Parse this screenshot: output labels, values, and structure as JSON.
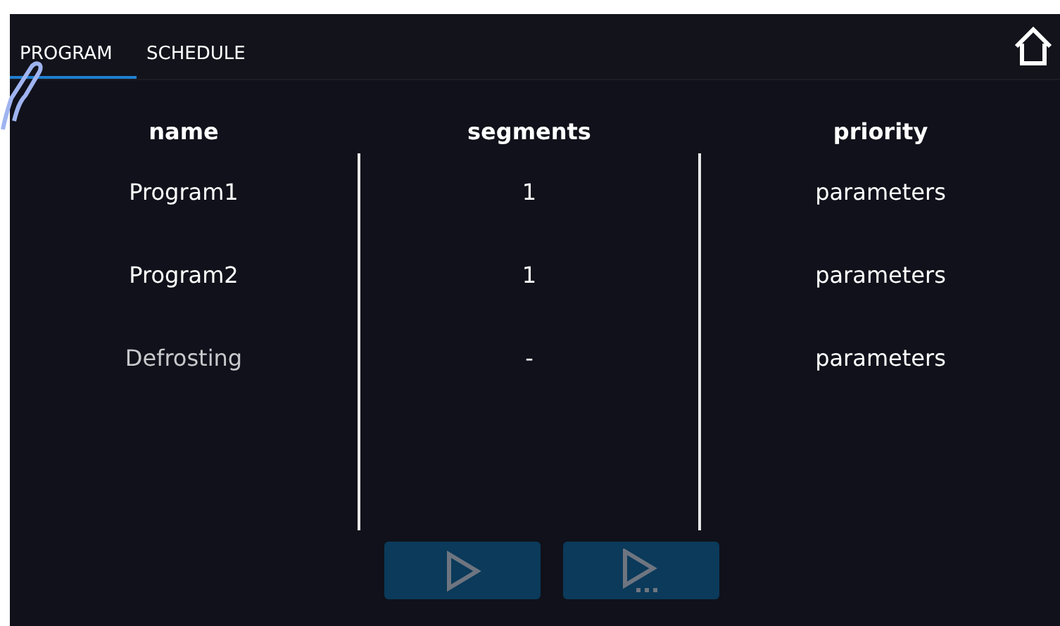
{
  "tabs": [
    {
      "label": "PROGRAM",
      "selected": true
    },
    {
      "label": "SCHEDULE",
      "selected": false
    }
  ],
  "table": {
    "columns": [
      "name",
      "segments",
      "priority"
    ],
    "rows": [
      {
        "name": "Program1",
        "segments": "1",
        "priority": "parameters",
        "dimmed": false
      },
      {
        "name": "Program2",
        "segments": "1",
        "priority": "parameters",
        "dimmed": false
      },
      {
        "name": "Defrosting",
        "segments": "-",
        "priority": "parameters",
        "dimmed": true
      }
    ]
  },
  "buttons": [
    {
      "kind": "start",
      "disabled": true
    },
    {
      "kind": "start-options",
      "disabled": true
    }
  ]
}
